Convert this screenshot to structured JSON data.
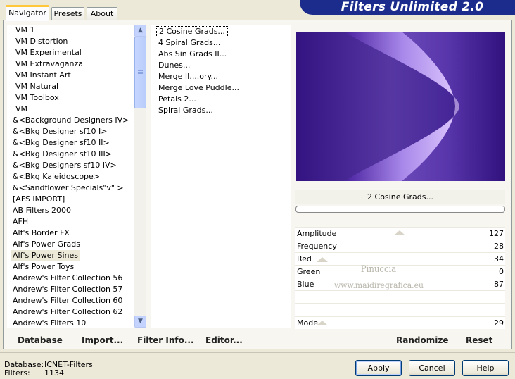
{
  "title": "Filters Unlimited 2.0",
  "tabs": [
    "Navigator",
    "Presets",
    "About"
  ],
  "active_tab": "Navigator",
  "categories": [
    "VM 1",
    "VM Distortion",
    "VM Experimental",
    "VM Extravaganza",
    "VM Instant Art",
    "VM Natural",
    "VM Toolbox",
    "VM",
    "&<Background Designers IV>",
    "&<Bkg Designer sf10 I>",
    "&<Bkg Designer sf10 II>",
    "&<Bkg Designer sf10 III>",
    "&<Bkg Designers sf10 IV>",
    "&<Bkg Kaleidoscope>",
    "&<Sandflower Specials\"v\" >",
    "[AFS IMPORT]",
    "AB Filters 2000",
    "AFH",
    "Alf's Border FX",
    "Alf's Power Grads",
    "Alf's Power Sines",
    "Alf's Power Toys",
    "Andrew's Filter Collection 56",
    "Andrew's Filter Collection 57",
    "Andrew's Filter Collection 60",
    "Andrew's Filter Collection 62",
    "Andrew's Filters 10"
  ],
  "selected_category": "Alf's Power Sines",
  "filters": [
    "2 Cosine Grads...",
    "4 Spiral Grads...",
    "Abs Sin Grads II...",
    "Dunes...",
    "Merge II....ory...",
    "Merge Love Puddle...",
    "Petals 2...",
    "Spiral Grads..."
  ],
  "selected_filter": "2 Cosine Grads...",
  "preview_label": "2 Cosine Grads...",
  "parameters": [
    {
      "name": "Amplitude",
      "value": "127"
    },
    {
      "name": "Frequency",
      "value": "28"
    },
    {
      "name": "Red",
      "value": "34"
    },
    {
      "name": "Green",
      "value": "0"
    },
    {
      "name": "Blue",
      "value": "87"
    }
  ],
  "mode_param": {
    "name": "Mode",
    "value": "29"
  },
  "watermark": {
    "line1": "Pinuccia",
    "line2": "www.maidiregrafica.eu"
  },
  "bottom_links": {
    "database": "Database",
    "import": "Import...",
    "filter_info": "Filter Info...",
    "editor": "Editor...",
    "randomize": "Randomize",
    "reset": "Reset"
  },
  "info": {
    "database_label": "Database:",
    "database_value": "ICNET-Filters",
    "filters_label": "Filters:",
    "filters_value": "1134"
  },
  "buttons": {
    "apply": "Apply",
    "cancel": "Cancel",
    "help": "Help"
  },
  "colors": {
    "banner": "#1c2c8c",
    "preview_dark": "#2c0f78",
    "preview_light": "#d8c0ff"
  }
}
